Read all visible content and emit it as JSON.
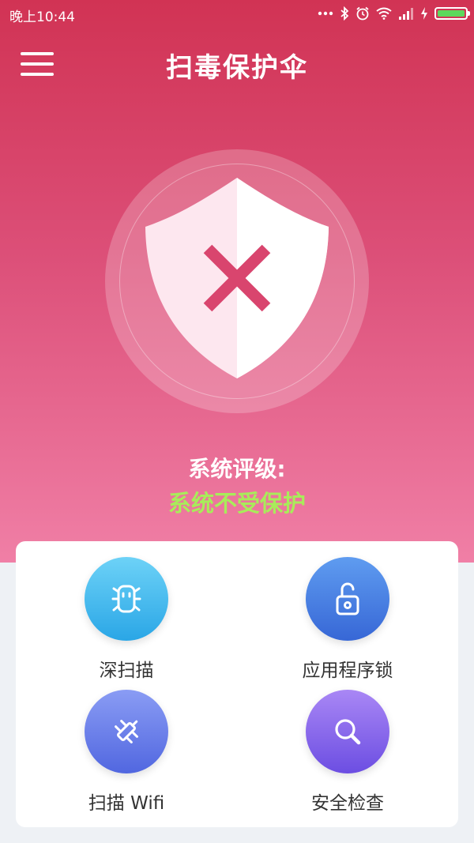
{
  "status_bar": {
    "time": "晚上10:44",
    "icons": [
      "more-dots-icon",
      "bluetooth-icon",
      "alarm-icon",
      "wifi-icon",
      "signal-icon",
      "charging-icon",
      "battery-icon"
    ],
    "battery_level": 1.0,
    "battery_color": "#5cd85c"
  },
  "header": {
    "title": "扫毒保护伞",
    "menu_icon": "hamburger-menu-icon"
  },
  "shield": {
    "icon": "shield-x-icon",
    "mark_color": "#d9456e"
  },
  "rating": {
    "label": "系统评级:",
    "value": "系统不受保护",
    "value_color": "#a8ec5a"
  },
  "actions": [
    {
      "label": "深扫描",
      "icon": "bug-icon"
    },
    {
      "label": "应用程序锁",
      "icon": "unlock-icon"
    },
    {
      "label": "扫描 Wifi",
      "icon": "satellite-icon"
    },
    {
      "label": "安全检查",
      "icon": "search-icon"
    }
  ],
  "colors": {
    "header_top": "#d13354",
    "header_bottom": "#f07fa6",
    "background": "#eef1f5"
  }
}
